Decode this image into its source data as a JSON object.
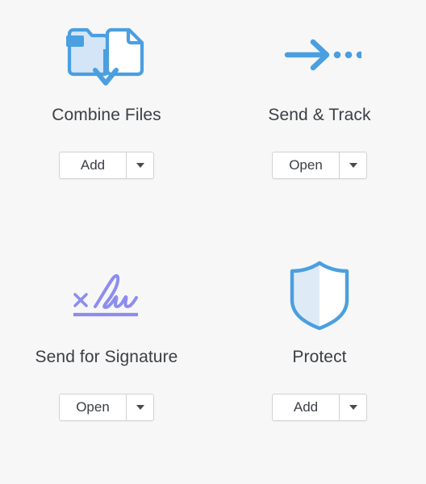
{
  "panel": {
    "background_color": "#f7f7f7",
    "label_color": "#3b3f44",
    "accent_blue": "#4a9fe0",
    "accent_blue_light": "#d3e5f7",
    "accent_purple": "#8d8df0",
    "button_border_color": "#d2d2d2",
    "button_background": "#ffffff"
  },
  "tools": [
    {
      "id": "combine-files",
      "label": "Combine Files",
      "icon": "combine-files-icon",
      "button": {
        "label": "Add",
        "dropdown_icon": "chevron-down-icon"
      }
    },
    {
      "id": "send-and-track",
      "label": "Send & Track",
      "icon": "send-and-track-icon",
      "button": {
        "label": "Open",
        "dropdown_icon": "chevron-down-icon"
      }
    },
    {
      "id": "send-for-signature",
      "label": "Send for Signature",
      "icon": "send-for-signature-icon",
      "button": {
        "label": "Open",
        "dropdown_icon": "chevron-down-icon"
      }
    },
    {
      "id": "protect",
      "label": "Protect",
      "icon": "protect-shield-icon",
      "button": {
        "label": "Add",
        "dropdown_icon": "chevron-down-icon"
      }
    }
  ]
}
